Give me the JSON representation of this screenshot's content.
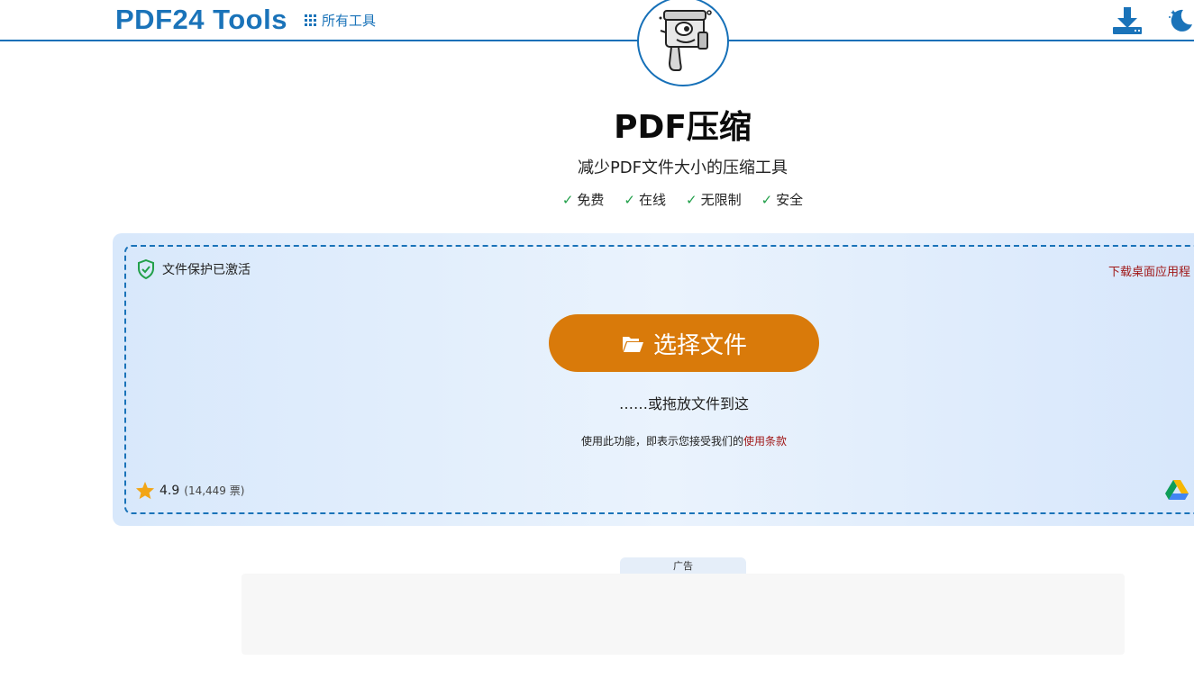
{
  "header": {
    "logo": "PDF24 Tools",
    "all_tools_label": "所有工具",
    "icons": [
      "grid-icon",
      "download-icon",
      "moon-icon"
    ]
  },
  "main": {
    "title": "PDF压缩",
    "subtitle": "减少PDF文件大小的压缩工具",
    "features": [
      {
        "check": "✓",
        "label": "免费"
      },
      {
        "check": "✓",
        "label": "在线"
      },
      {
        "check": "✓",
        "label": "无限制"
      },
      {
        "check": "✓",
        "label": "安全"
      }
    ]
  },
  "upload": {
    "protection_label": "文件保护已激活",
    "desktop_link": "下载桌面应用程",
    "choose_button": "选择文件",
    "drop_text": "……或拖放文件到这",
    "terms_prefix": "使用此功能，即表示您接受我们的",
    "terms_link": "使用条款",
    "rating_value": "4.9",
    "rating_votes": "(14,449 票)"
  },
  "ad": {
    "label": "广告"
  },
  "colors": {
    "brand_blue": "#1a73b9",
    "button_orange": "#d97a0a",
    "link_red": "#a01818",
    "check_green": "#22a04a",
    "star": "#f2a516"
  }
}
